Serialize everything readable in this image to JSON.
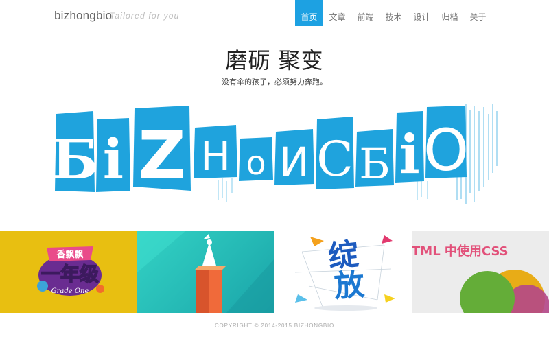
{
  "header": {
    "brand": "bizhongbio",
    "tagline": "Tailored for you",
    "nav": [
      {
        "label": "首页",
        "active": true
      },
      {
        "label": "文章",
        "active": false
      },
      {
        "label": "前端",
        "active": false
      },
      {
        "label": "技术",
        "active": false
      },
      {
        "label": "设计",
        "active": false
      },
      {
        "label": "归档",
        "active": false
      },
      {
        "label": "关于",
        "active": false
      }
    ]
  },
  "hero": {
    "title": "磨砺 聚变",
    "subtitle": "没有伞的孩子，必须努力奔跑。",
    "logo_letters": [
      "Б",
      "i",
      "Z",
      "H",
      "o",
      "И",
      "C",
      "Б",
      "i",
      "O"
    ]
  },
  "tiles": [
    {
      "badge": "香飘飘",
      "title": "一年级",
      "sub": "Grade One"
    },
    {},
    {
      "title1": "绽",
      "title2": "放"
    },
    {
      "title": "TML 中使用CSS"
    }
  ],
  "footer": {
    "text": "COPYRIGHT © 2014-2015 BIZHONGBIO"
  },
  "colors": {
    "accent": "#1da1e2",
    "logo_blue": "#1fa3dd"
  }
}
